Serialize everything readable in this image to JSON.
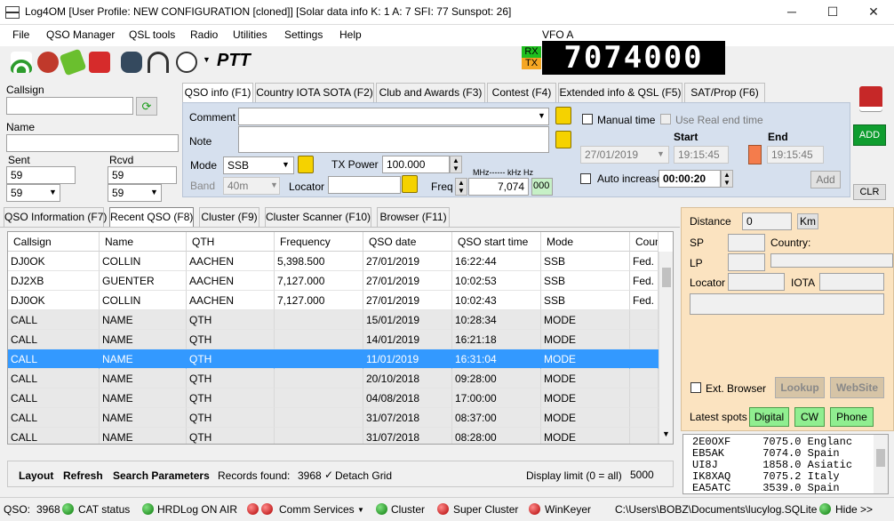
{
  "window": {
    "title": "Log4OM [User Profile: NEW CONFIGURATION [cloned]] [Solar data info K: 1 A: 7 SFI: 77 Sunspot: 26]",
    "min_glyph": "─",
    "max_glyph": "☐",
    "close_glyph": "✕"
  },
  "menu": [
    "File",
    "QSO Manager",
    "QSL tools",
    "Radio",
    "Utilities",
    "Settings",
    "Help"
  ],
  "toolbar": {
    "ptt_label": "PTT",
    "vfo_label": "VFO A",
    "rx_label": "RX",
    "tx_label": "TX",
    "frequency_display": "7074000"
  },
  "left": {
    "callsign_label": "Callsign",
    "callsign_value": "",
    "name_label": "Name",
    "name_value": "",
    "sent_label": "Sent",
    "sent_value": "59",
    "sent_select": "59",
    "rcvd_label": "Rcvd",
    "rcvd_value": "59",
    "rcvd_select": "59"
  },
  "qso_tabs": [
    "QSO info (F1)",
    "Country IOTA SOTA (F2)",
    "Club and Awards (F3)",
    "Contest (F4)",
    "Extended info & QSL (F5)",
    "SAT/Prop (F6)"
  ],
  "qso": {
    "comment_label": "Comment",
    "note_label": "Note",
    "mode_label": "Mode",
    "mode_value": "SSB",
    "band_label": "Band",
    "band_value": "40m",
    "txpower_label": "TX Power",
    "txpower_value": "100.000",
    "locator_label": "Locator",
    "freq_label": "Freq",
    "freq_units": "MHz------ kHz   Hz",
    "freq_value": "7,074",
    "freq_hz": "000",
    "manual_time_label": "Manual time",
    "real_end_label": "Use Real end time",
    "start_label": "Start",
    "end_label": "End",
    "date_value": "27/01/2019",
    "start_value": "19:15:45",
    "end_value": "19:15:45",
    "auto_inc_label": "Auto increase",
    "auto_inc_value": "00:00:20",
    "add_small_label": "Add"
  },
  "right_buttons": {
    "add_label": "ADD",
    "clr_label": "CLR"
  },
  "lower_tabs": [
    "QSO Information (F7)",
    "Recent QSO (F8)",
    "Cluster (F9)",
    "Cluster Scanner (F10)",
    "Browser (F11)"
  ],
  "grid": {
    "columns": [
      "Callsign",
      "Name",
      "QTH",
      "Frequency",
      "QSO date",
      "QSO start time",
      "Mode",
      "Coun"
    ],
    "rows": [
      [
        "DJ0OK",
        "COLLIN",
        "AACHEN",
        "5,398.500",
        "27/01/2019",
        "16:22:44",
        "SSB",
        "Fed. R"
      ],
      [
        "DJ2XB",
        "GUENTER",
        "AACHEN",
        "7,127.000",
        "27/01/2019",
        "10:02:53",
        "SSB",
        "Fed. R"
      ],
      [
        "DJ0OK",
        "COLLIN",
        "AACHEN",
        "7,127.000",
        "27/01/2019",
        "10:02:43",
        "SSB",
        "Fed. R"
      ],
      [
        "CALL",
        "NAME",
        "QTH",
        "",
        "15/01/2019",
        "10:28:34",
        "MODE",
        ""
      ],
      [
        "CALL",
        "NAME",
        "QTH",
        "",
        "14/01/2019",
        "16:21:18",
        "MODE",
        ""
      ],
      [
        "CALL",
        "NAME",
        "QTH",
        "",
        "11/01/2019",
        "16:31:04",
        "MODE",
        ""
      ],
      [
        "CALL",
        "NAME",
        "QTH",
        "",
        "20/10/2018",
        "09:28:00",
        "MODE",
        ""
      ],
      [
        "CALL",
        "NAME",
        "QTH",
        "",
        "04/08/2018",
        "17:00:00",
        "MODE",
        ""
      ],
      [
        "CALL",
        "NAME",
        "QTH",
        "",
        "31/07/2018",
        "08:37:00",
        "MODE",
        ""
      ],
      [
        "CALL",
        "NAME",
        "QTH",
        "",
        "31/07/2018",
        "08:28:00",
        "MODE",
        ""
      ]
    ],
    "selected_row": 5
  },
  "grid_footer": {
    "layout": "Layout",
    "refresh": "Refresh",
    "search": "Search Parameters",
    "records_label": "Records found:",
    "records_value": "3968",
    "detach": "Detach Grid",
    "display_limit_label": "Display limit (0 = all)",
    "display_limit_value": "5000"
  },
  "info": {
    "distance_label": "Distance",
    "distance_value": "0",
    "km_label": "Km",
    "sp_label": "SP",
    "country_label": "Country:",
    "lp_label": "LP",
    "locator_label": "Locator",
    "iota_label": "IOTA",
    "ext_browser_label": "Ext. Browser",
    "lookup_label": "Lookup",
    "website_label": "WebSite",
    "latest_spots_label": "Latest spots",
    "digital_label": "Digital",
    "cw_label": "CW",
    "phone_label": "Phone"
  },
  "spots": [
    "2E0OXF     7075.0 Englanc",
    "EB5AK      7074.0 Spain",
    "UI8J       1858.0 Asiatic",
    "IK8XAQ     7075.2 Italy",
    "EA5ATC     3539.0 Spain"
  ],
  "status": {
    "qso_label": "QSO:",
    "qso_count": "3968",
    "cat": "CAT status",
    "hrdlog": "HRDLog ON AIR",
    "comm": "Comm Services",
    "cluster": "Cluster",
    "super_cluster": "Super Cluster",
    "winkeyer": "WinKeyer",
    "db_path": "C:\\Users\\BOBZ\\Documents\\lucylog.SQLite",
    "hide": "Hide >>"
  },
  "colors": {
    "panel": "#d6e0ee",
    "info_panel": "#fbe3c0",
    "selected": "#3399ff",
    "add_button": "#0f9d2f",
    "spot_button": "#90ee90"
  }
}
